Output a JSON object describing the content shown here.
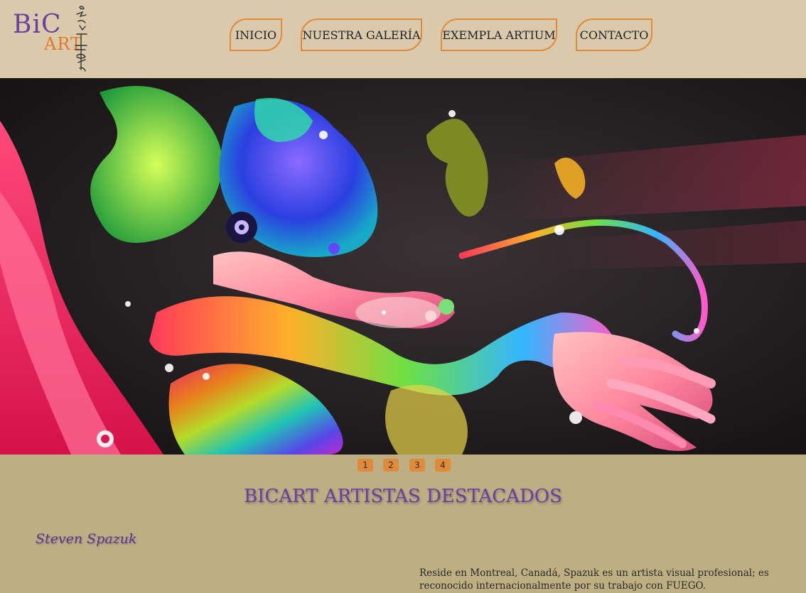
{
  "logo": {
    "text_bic": "BiC",
    "text_art": "ART"
  },
  "nav": {
    "items": [
      {
        "label": "INICIO"
      },
      {
        "label": "NUESTRA GALERÍA"
      },
      {
        "label": "EXEMPLA ARTIUM"
      },
      {
        "label": "CONTACTO"
      }
    ]
  },
  "slider": {
    "pages": [
      "1",
      "2",
      "3",
      "4"
    ]
  },
  "main": {
    "title": "BICART ARTISTAS DESTACADOS",
    "artist": {
      "name": "Steven Spazuk",
      "bio": "Reside en Montreal, Canadá, Spazuk es un artista visual profesional; es reconocido internacionalmente por su trabajo con FUEGO."
    }
  },
  "colors": {
    "header_bg": "#dac9ab",
    "body_bg": "#bdaf82",
    "accent_orange": "#e08a3c",
    "accent_purple": "#6b3fa0"
  }
}
